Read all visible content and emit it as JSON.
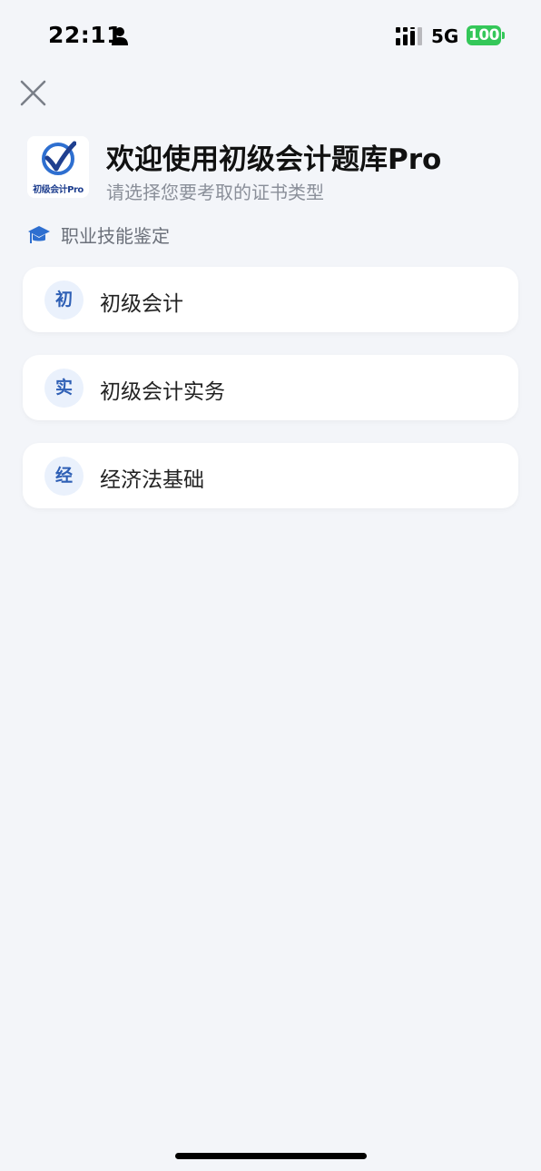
{
  "status_bar": {
    "time": "22:11",
    "network": "5G",
    "battery": "100",
    "battery_color": "#34c759"
  },
  "header": {
    "logo_text": "初级会计Pro",
    "title": "欢迎使用初级会计题库Pro",
    "subtitle": "请选择您要考取的证书类型"
  },
  "section": {
    "icon": "graduation-cap-icon",
    "title": "职业技能鉴定"
  },
  "options": [
    {
      "badge": "初",
      "label": "初级会计"
    },
    {
      "badge": "实",
      "label": "初级会计实务"
    },
    {
      "badge": "经",
      "label": "经济法基础"
    }
  ],
  "colors": {
    "background": "#f3f5f9",
    "accent": "#2e5fb5",
    "badge_bg": "#eaf1fc"
  }
}
